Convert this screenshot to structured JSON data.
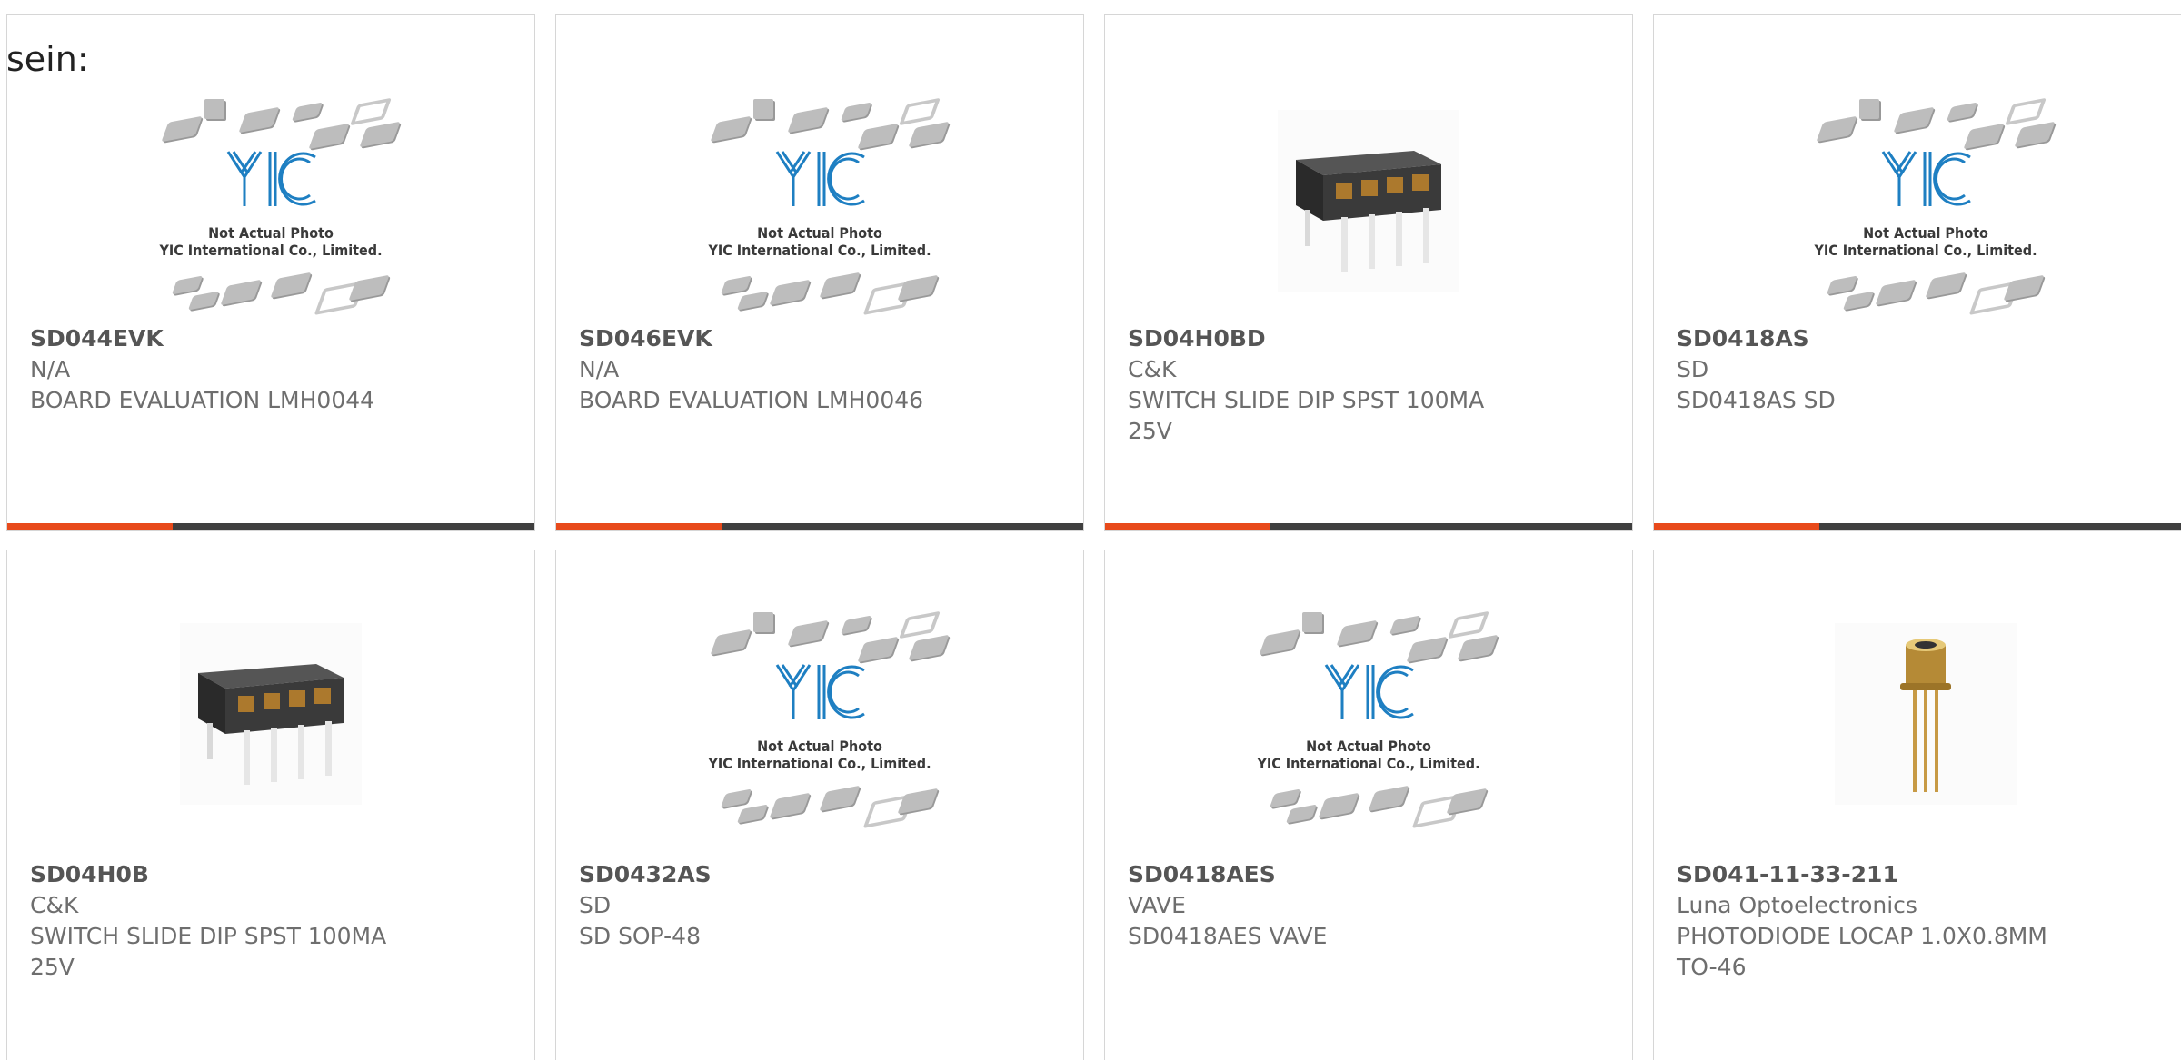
{
  "lead_text": "sein:",
  "colors": {
    "accent": "#e84a1b",
    "bar": "#3f3f3f",
    "text": "#6e6e6e",
    "logo_blue": "#1e7fc2"
  },
  "placeholder": {
    "line1": "Not Actual Photo",
    "line2": "YIC International Co., Limited.",
    "logo_text": "YIC"
  },
  "products": [
    {
      "part": "SD044EVK",
      "manufacturer": "N/A",
      "description": "BOARD EVALUATION LMH0044",
      "image": "placeholder"
    },
    {
      "part": "SD046EVK",
      "manufacturer": "N/A",
      "description": "BOARD EVALUATION LMH0046",
      "image": "placeholder"
    },
    {
      "part": "SD04H0BD",
      "manufacturer": "C&K",
      "description": "SWITCH SLIDE DIP SPST 100MA 25V",
      "image": "dip-switch"
    },
    {
      "part": "SD0418AS",
      "manufacturer": "SD",
      "description": "SD0418AS SD",
      "image": "placeholder"
    },
    {
      "part": "SD04H0B",
      "manufacturer": "C&K",
      "description": "SWITCH SLIDE DIP SPST 100MA 25V",
      "image": "dip-switch"
    },
    {
      "part": "SD0432AS",
      "manufacturer": "SD",
      "description": "SD SOP-48",
      "image": "placeholder"
    },
    {
      "part": "SD0418AES",
      "manufacturer": "VAVE",
      "description": "SD0418AES VAVE",
      "image": "placeholder"
    },
    {
      "part": "SD041-11-33-211",
      "manufacturer": "Luna Optoelectronics",
      "description": "PHOTODIODE LOCAP 1.0X0.8MM TO-46",
      "image": "photodiode"
    }
  ]
}
